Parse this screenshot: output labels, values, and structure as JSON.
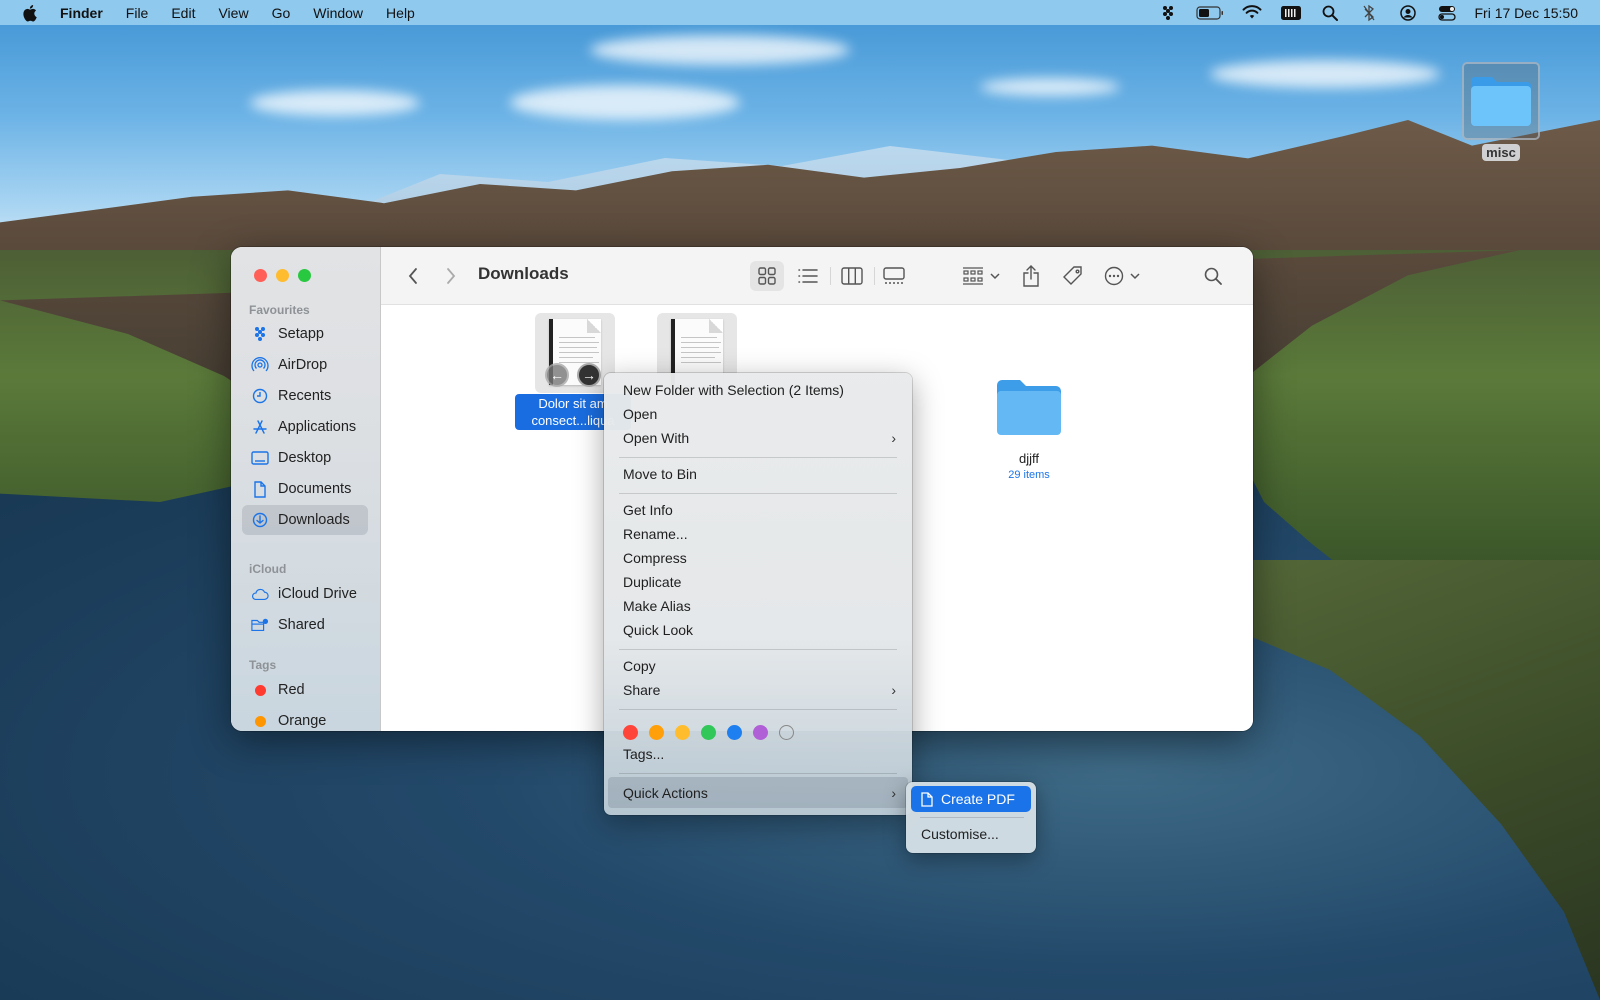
{
  "menubar": {
    "app_name": "Finder",
    "menus": [
      "File",
      "Edit",
      "View",
      "Go",
      "Window",
      "Help"
    ],
    "status_icons": [
      "setapp-icon",
      "battery-icon",
      "wifi-icon",
      "keyboard-icon",
      "spotlight-icon",
      "bluetooth-icon",
      "user-icon",
      "control-center-icon"
    ],
    "clock": "Fri 17 Dec  15:50"
  },
  "desktop": {
    "icons": [
      {
        "label": "misc",
        "type": "folder"
      }
    ]
  },
  "finder": {
    "title": "Downloads",
    "sidebar": {
      "favourites_header": "Favourites",
      "favourites": [
        {
          "label": "Setapp",
          "icon": "setapp-icon"
        },
        {
          "label": "AirDrop",
          "icon": "airdrop-icon"
        },
        {
          "label": "Recents",
          "icon": "clock-icon"
        },
        {
          "label": "Applications",
          "icon": "applications-icon"
        },
        {
          "label": "Desktop",
          "icon": "desktop-icon"
        },
        {
          "label": "Documents",
          "icon": "document-icon"
        },
        {
          "label": "Downloads",
          "icon": "download-icon",
          "selected": true
        }
      ],
      "icloud_header": "iCloud",
      "icloud": [
        {
          "label": "iCloud Drive",
          "icon": "cloud-icon"
        },
        {
          "label": "Shared",
          "icon": "shared-folder-icon"
        }
      ],
      "tags_header": "Tags",
      "tags": [
        {
          "label": "Red",
          "color": "#ff3b30"
        },
        {
          "label": "Orange",
          "color": "#ff9500"
        }
      ]
    },
    "toolbar": {
      "view_modes": [
        "icon-view",
        "list-view",
        "column-view",
        "gallery-view"
      ],
      "selected_view": "icon-view"
    },
    "files": [
      {
        "name_line1": "Dolor sit am",
        "name_line2": "consect...liqua",
        "type": "document",
        "selected": true
      },
      {
        "name_line1": "",
        "name_line2": "",
        "type": "document",
        "selected": true
      },
      {
        "name": "djjff",
        "type": "folder",
        "subtitle": "29 items"
      }
    ]
  },
  "context_menu": {
    "items": [
      {
        "label": "New Folder with Selection (2 Items)"
      },
      {
        "label": "Open"
      },
      {
        "label": "Open With",
        "submenu": true
      },
      {
        "label": "Move to Bin"
      },
      {
        "label": "Get Info"
      },
      {
        "label": "Rename..."
      },
      {
        "label": "Compress"
      },
      {
        "label": "Duplicate"
      },
      {
        "label": "Make Alias"
      },
      {
        "label": "Quick Look"
      },
      {
        "label": "Copy"
      },
      {
        "label": "Share",
        "submenu": true
      },
      {
        "label": "Tags..."
      },
      {
        "label": "Quick Actions",
        "submenu": true,
        "highlighted": true
      }
    ],
    "tag_colors": [
      "#ff453a",
      "#ff9f0a",
      "#ffbd2e",
      "#32c759",
      "#1e7ff0",
      "#b05fd6",
      "none"
    ]
  },
  "quick_actions_submenu": {
    "items": [
      {
        "label": "Create PDF",
        "icon": "document-icon",
        "highlighted": true
      },
      {
        "label": "Customise..."
      }
    ]
  }
}
